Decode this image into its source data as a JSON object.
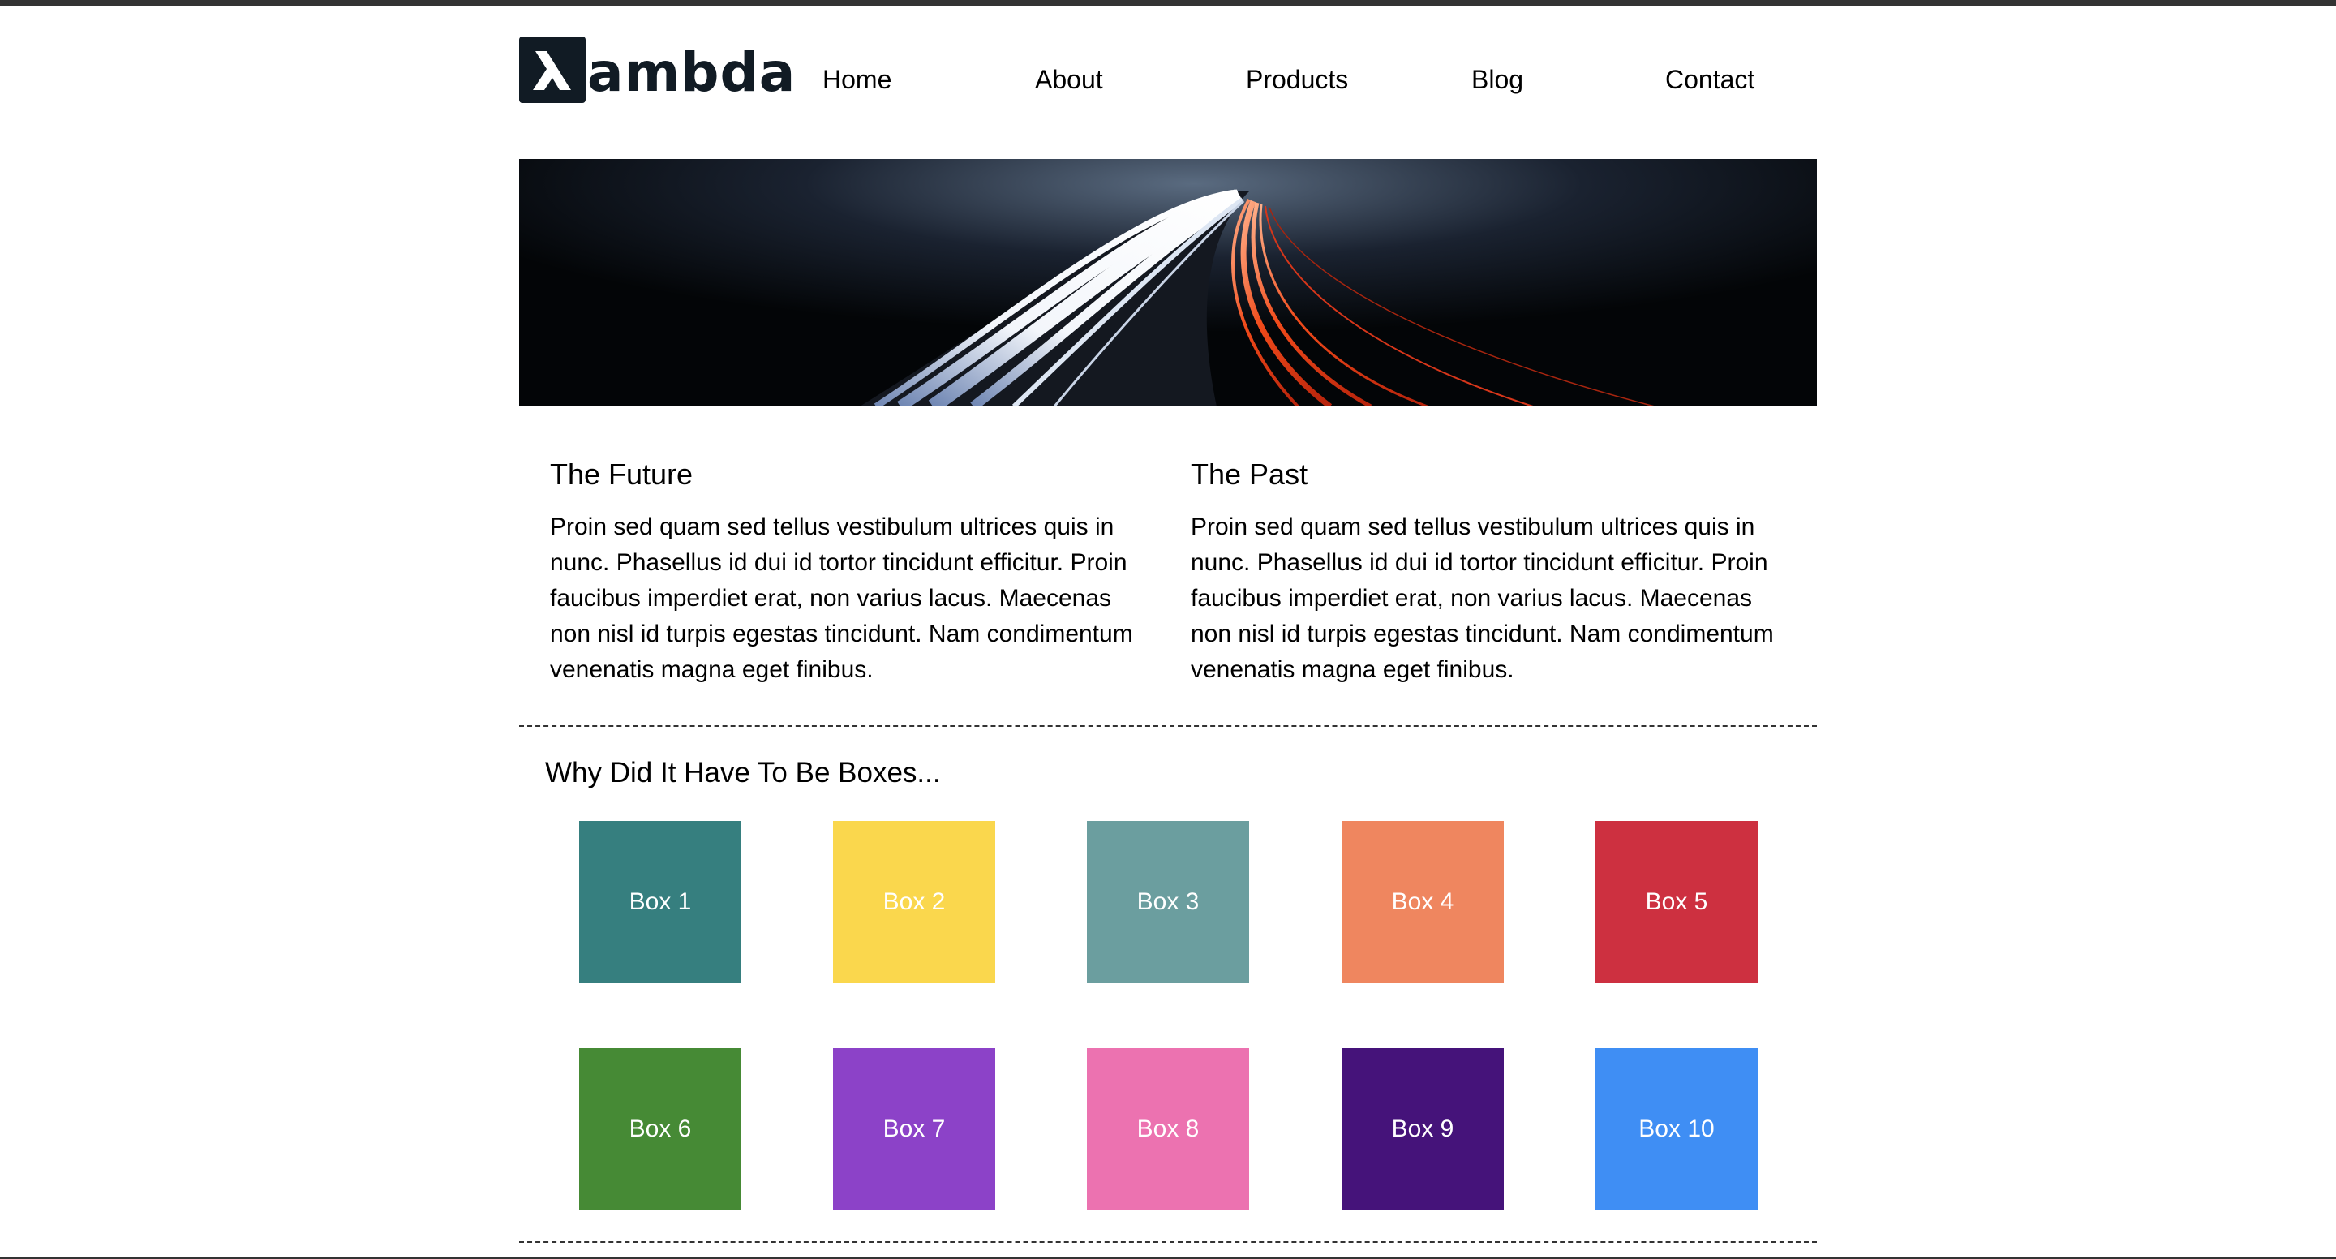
{
  "logo": {
    "icon": "lambda-icon",
    "text": "ambda"
  },
  "nav": {
    "items": [
      {
        "label": "Home"
      },
      {
        "label": "About"
      },
      {
        "label": "Products"
      },
      {
        "label": "Blog"
      },
      {
        "label": "Contact"
      }
    ]
  },
  "hero": {
    "alt": "long-exposure highway light trails at night"
  },
  "columns": [
    {
      "title": "The Future",
      "text": "Proin sed quam sed tellus vestibulum ultrices quis in nunc. Phasellus id dui id tortor tincidunt efficitur. Proin faucibus imperdiet erat, non varius lacus. Maecenas non nisl id turpis egestas tincidunt. Nam condimentum venenatis magna eget finibus."
    },
    {
      "title": "The Past",
      "text": "Proin sed quam sed tellus vestibulum ultrices quis in nunc. Phasellus id dui id tortor tincidunt efficitur. Proin faucibus imperdiet erat, non varius lacus. Maecenas non nisl id turpis egestas tincidunt. Nam condimentum venenatis magna eget finibus."
    }
  ],
  "boxes": {
    "title": "Why Did It Have To Be Boxes...",
    "items": [
      {
        "label": "Box 1",
        "color": "#367f7f"
      },
      {
        "label": "Box 2",
        "color": "#fad74d"
      },
      {
        "label": "Box 3",
        "color": "#6b9e9f"
      },
      {
        "label": "Box 4",
        "color": "#ef865f"
      },
      {
        "label": "Box 5",
        "color": "#cd3040"
      },
      {
        "label": "Box 6",
        "color": "#468a35"
      },
      {
        "label": "Box 7",
        "color": "#8c42c8"
      },
      {
        "label": "Box 8",
        "color": "#ec72b0"
      },
      {
        "label": "Box 9",
        "color": "#45137a"
      },
      {
        "label": "Box 10",
        "color": "#3f8ef4"
      }
    ]
  }
}
